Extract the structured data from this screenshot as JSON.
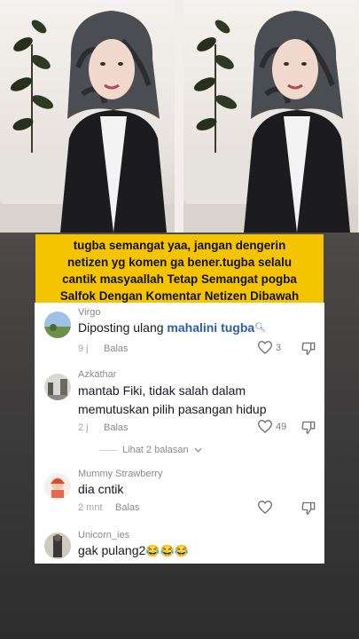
{
  "caption": {
    "line1": "tugba semangat yaa, jangan dengerin",
    "line2": "netizen yg komen ga bener.tugba selalu",
    "line3": "cantik masyaallah Tetap Semangat pogba",
    "line4": "Salfok Dengan Komentar Netizen Dibawah"
  },
  "comments": [
    {
      "user": "Virgo",
      "text": "Diposting ulang ",
      "mention": "mahalini tugba",
      "time": "9 j",
      "reply": "Balas",
      "likes": "3"
    },
    {
      "user": "Azkathar",
      "text": "mantab Fiki, tidak salah dalam memutuskan pilih pasangan hidup",
      "time": "2 j",
      "reply": "Balas",
      "likes": "49",
      "view_replies": "Lihat 2 balasan"
    },
    {
      "user": "Mummy Strawberry",
      "text": "dia cntik",
      "time": "2 mnt",
      "reply": "Balas",
      "likes": ""
    },
    {
      "user": "Unicorn_ies",
      "text": "gak pulang2",
      "emojis": "😂😂😂"
    }
  ],
  "icons": {
    "like": "heart-icon",
    "dislike": "thumbs-down-icon",
    "chevron": "chevron-down-icon",
    "search": "search-icon"
  },
  "colors": {
    "caption_bg": "#f4c400",
    "mention": "#2b5ea8"
  }
}
